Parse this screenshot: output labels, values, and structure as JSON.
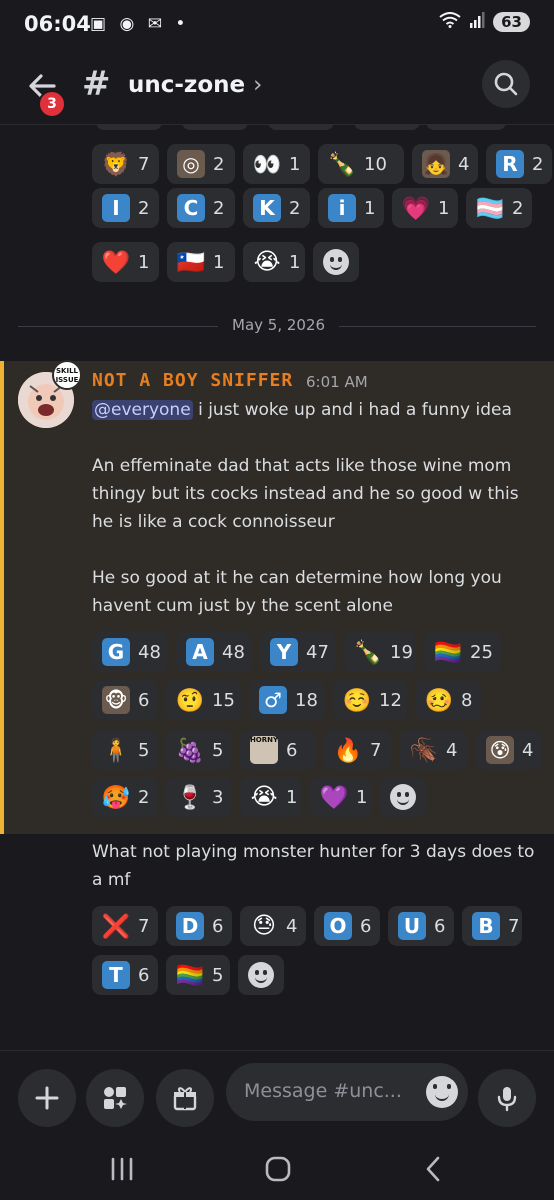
{
  "status": {
    "time": "06:04",
    "battery": "63"
  },
  "header": {
    "channel": "unc-zone",
    "badge": "3"
  },
  "divider_date": "May 5, 2026",
  "prev_reactions": {
    "row1": [
      {
        "emoji": "🦁",
        "kind": "plain",
        "count": "7"
      },
      {
        "emoji": "◎",
        "kind": "photo",
        "count": "2"
      },
      {
        "emoji": "👀",
        "kind": "plain",
        "count": "1"
      },
      {
        "emoji": "🍾",
        "kind": "plain",
        "count": "10"
      },
      {
        "emoji": "👧",
        "kind": "photo",
        "count": "4"
      },
      {
        "emoji": "R",
        "kind": "blue",
        "count": "2"
      }
    ],
    "row2": [
      {
        "emoji": "I",
        "kind": "blue",
        "count": "2"
      },
      {
        "emoji": "C",
        "kind": "blue",
        "count": "2"
      },
      {
        "emoji": "K",
        "kind": "blue",
        "count": "2"
      },
      {
        "emoji": "i",
        "kind": "blue",
        "count": "1"
      },
      {
        "emoji": "💗",
        "kind": "plain",
        "count": "1"
      },
      {
        "emoji": "🏳️‍⚧️",
        "kind": "plain",
        "count": "2"
      }
    ],
    "row3": [
      {
        "emoji": "❤️",
        "kind": "plain",
        "count": "1"
      },
      {
        "emoji": "🇨🇱",
        "kind": "plain",
        "count": "1"
      },
      {
        "emoji": "😭",
        "kind": "plain",
        "count": "1"
      }
    ]
  },
  "message": {
    "author": "NOT A BOY SNIFFER",
    "time": "6:01 AM",
    "avatar_badge": "SKILL ISSUE",
    "mention": "@everyone",
    "line1_rest": " i just woke up and i had a funny idea",
    "para2": "An effeminate dad that acts like those wine mom thingy but its cocks instead and he so good w this he is like a cock connoisseur",
    "para3": "He so good at it he can determine how long you havent cum just by the scent alone",
    "reactions": {
      "row1": [
        {
          "emoji": "G",
          "kind": "blue",
          "count": "48"
        },
        {
          "emoji": "A",
          "kind": "blue",
          "count": "48"
        },
        {
          "emoji": "Y",
          "kind": "blue",
          "count": "47"
        },
        {
          "emoji": "🍾",
          "kind": "plain",
          "count": "19"
        },
        {
          "emoji": "🏳️‍🌈",
          "kind": "plain",
          "count": "25"
        }
      ],
      "row2": [
        {
          "emoji": "🐵",
          "kind": "photo",
          "count": "6"
        },
        {
          "emoji": "🤨",
          "kind": "plain",
          "count": "15"
        },
        {
          "emoji": "♂",
          "kind": "blue",
          "count": "18"
        },
        {
          "emoji": "☺️",
          "kind": "plain",
          "count": "12"
        },
        {
          "emoji": "🥴",
          "kind": "plain",
          "count": "8"
        }
      ],
      "row3": [
        {
          "emoji": "🧍",
          "kind": "plain",
          "count": "5"
        },
        {
          "emoji": "🍇",
          "kind": "plain",
          "count": "5"
        },
        {
          "emoji": "HORNY",
          "kind": "photo",
          "count": "6"
        },
        {
          "emoji": "🔥",
          "kind": "plain",
          "count": "7"
        },
        {
          "emoji": "🪳",
          "kind": "plain",
          "count": "4"
        },
        {
          "emoji": "😰",
          "kind": "photo",
          "count": "4"
        }
      ],
      "row4": [
        {
          "emoji": "🥵",
          "kind": "plain",
          "count": "2"
        },
        {
          "emoji": "🍷",
          "kind": "plain",
          "count": "3"
        },
        {
          "emoji": "😭",
          "kind": "plain",
          "count": "1"
        },
        {
          "emoji": "💜",
          "kind": "plain",
          "count": "1"
        }
      ]
    }
  },
  "message2": {
    "text": "What not playing monster hunter for 3 days does to a mf",
    "reactions": {
      "row1": [
        {
          "emoji": "❌",
          "kind": "plain",
          "count": "7"
        },
        {
          "emoji": "D",
          "kind": "blue",
          "count": "6"
        },
        {
          "emoji": "😓",
          "kind": "plain",
          "count": "4"
        },
        {
          "emoji": "O",
          "kind": "blue",
          "count": "6"
        },
        {
          "emoji": "U",
          "kind": "blue",
          "count": "6"
        },
        {
          "emoji": "B",
          "kind": "blue",
          "count": "7"
        }
      ],
      "row2": [
        {
          "emoji": "T",
          "kind": "blue",
          "count": "6"
        },
        {
          "emoji": "🏳️‍🌈",
          "kind": "plain",
          "count": "5"
        }
      ]
    }
  },
  "composer": {
    "placeholder": "Message #unc..."
  },
  "colors": {
    "accent_highlight": "#f0b232",
    "author": "#e67e22",
    "badge": "#e0303a",
    "reaction_bg": "#2b2d31"
  }
}
